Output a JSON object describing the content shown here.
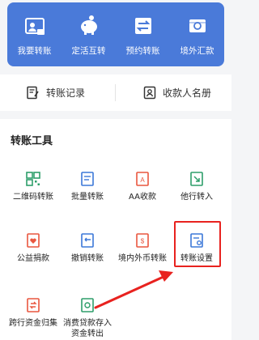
{
  "quick_actions": [
    {
      "label": "我要转账",
      "icon": "transfer-card-icon"
    },
    {
      "label": "定活互转",
      "icon": "piggy-bank-icon"
    },
    {
      "label": "预约转账",
      "icon": "scheduled-transfer-icon"
    },
    {
      "label": "境外汇款",
      "icon": "overseas-remittance-icon"
    }
  ],
  "records": {
    "history_label": "转账记录",
    "payee_label": "收款人名册"
  },
  "tools": {
    "title": "转账工具",
    "items": [
      {
        "label": "二维码转账",
        "icon": "qr-code-icon"
      },
      {
        "label": "批量转账",
        "icon": "batch-transfer-icon"
      },
      {
        "label": "AA收款",
        "icon": "aa-collect-icon"
      },
      {
        "label": "他行转入",
        "icon": "other-bank-in-icon"
      },
      {
        "label": "公益捐款",
        "icon": "charity-donation-icon"
      },
      {
        "label": "撤销转账",
        "icon": "cancel-transfer-icon"
      },
      {
        "label": "境内外币转账",
        "icon": "foreign-currency-icon"
      },
      {
        "label": "转账设置",
        "icon": "transfer-settings-icon"
      },
      {
        "label": "跨行资金归集",
        "icon": "fund-collection-icon"
      },
      {
        "label": "消费贷款存入",
        "label2": "资金转出",
        "icon": "loan-deposit-icon"
      }
    ]
  },
  "colors": {
    "primary": "#4a7ad9",
    "accent": "#e9573f",
    "highlight": "#e8221f"
  }
}
